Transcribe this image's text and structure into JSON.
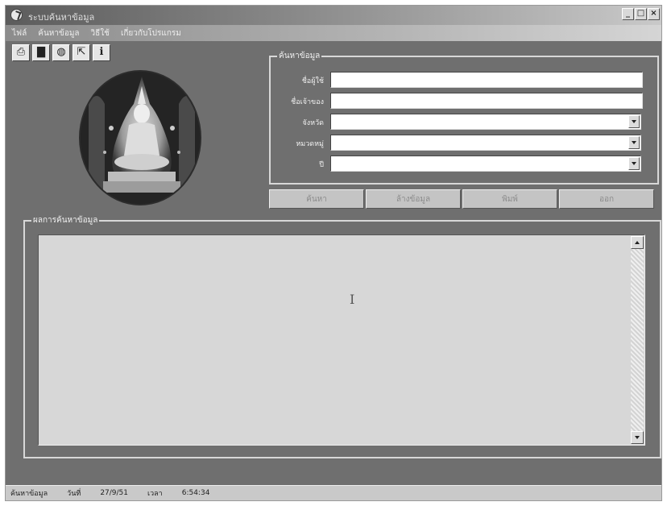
{
  "window": {
    "title": "ระบบค้นหาข้อมูล",
    "controls": [
      "_",
      "□",
      "×"
    ]
  },
  "menu": [
    "ไฟล์",
    "ค้นหาข้อมูล",
    "วิธีใช้",
    "เกี่ยวกับโปรแกรม"
  ],
  "toolbar": [
    {
      "name": "print",
      "glyph": "⎙"
    },
    {
      "name": "save",
      "glyph": "▇"
    },
    {
      "name": "globe",
      "glyph": "◍"
    },
    {
      "name": "select",
      "glyph": "⇱"
    },
    {
      "name": "info",
      "glyph": "ℹ"
    }
  ],
  "search": {
    "legend": "ค้นหาข้อมูล",
    "fields": [
      {
        "label": "ชื่อผู้ใช้",
        "value": ""
      },
      {
        "label": "ชื่อเจ้าของ",
        "value": ""
      }
    ],
    "selects": [
      {
        "label": "จังหวัด",
        "value": ""
      },
      {
        "label": "หมวดหมู่",
        "value": ""
      },
      {
        "label": "ปี",
        "value": ""
      }
    ]
  },
  "actions": [
    "ค้นหา",
    "ล้างข้อมูล",
    "พิมพ์",
    "ออก"
  ],
  "result": {
    "legend": "ผลการค้นหาข้อมูล",
    "text": ""
  },
  "status": {
    "state": "ค้นหาข้อมูล",
    "day": "วันที่",
    "date": "27/9/51",
    "time_label": "เวลา",
    "time": "6:54:34"
  },
  "colors": {
    "window_bg": "#6f6f6f",
    "titlebar_start": "#5c5c5c",
    "result_bg": "#d7d7d7"
  }
}
